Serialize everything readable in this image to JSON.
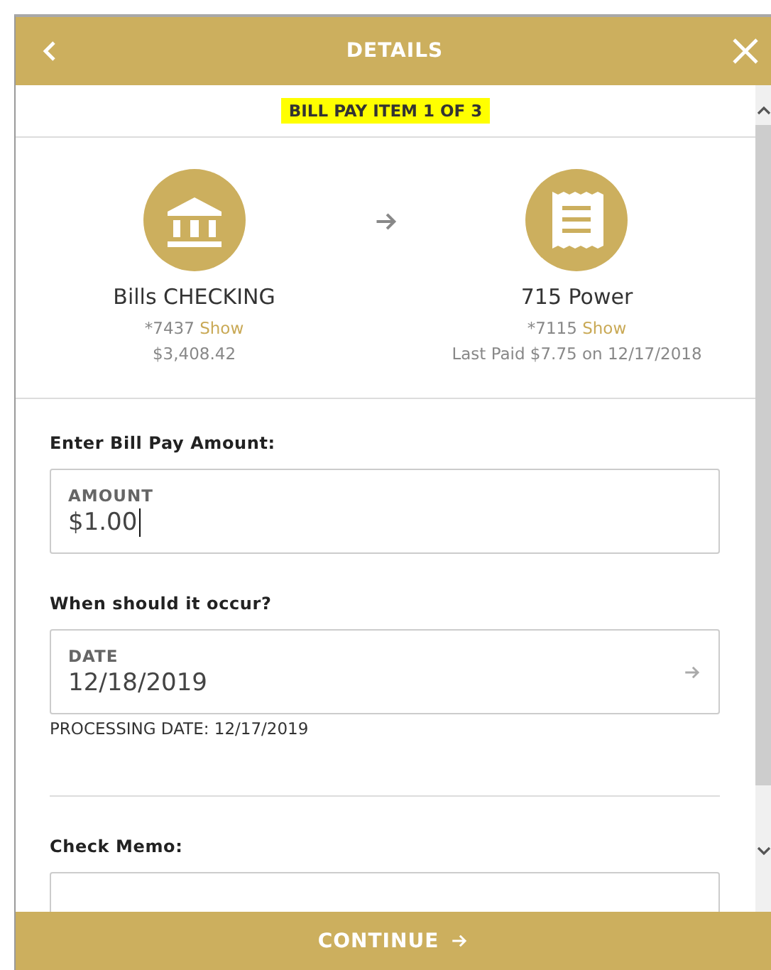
{
  "header": {
    "title": "DETAILS"
  },
  "banner": "BILL PAY ITEM 1 OF 3",
  "from": {
    "name": "Bills CHECKING",
    "masked": "*7437",
    "link": "Show",
    "detail": "$3,408.42"
  },
  "to": {
    "name": "715 Power",
    "masked": "*7115",
    "link": "Show",
    "detail": "Last Paid $7.75 on 12/17/2018"
  },
  "amount": {
    "label": "Enter Bill Pay Amount:",
    "field_label": "AMOUNT",
    "value": "$1.00"
  },
  "date": {
    "label": "When should it occur?",
    "field_label": "DATE",
    "value": "12/18/2019",
    "note": "PROCESSING DATE: 12/17/2019"
  },
  "memo": {
    "label": "Check Memo:"
  },
  "continue_button": "CONTINUE"
}
